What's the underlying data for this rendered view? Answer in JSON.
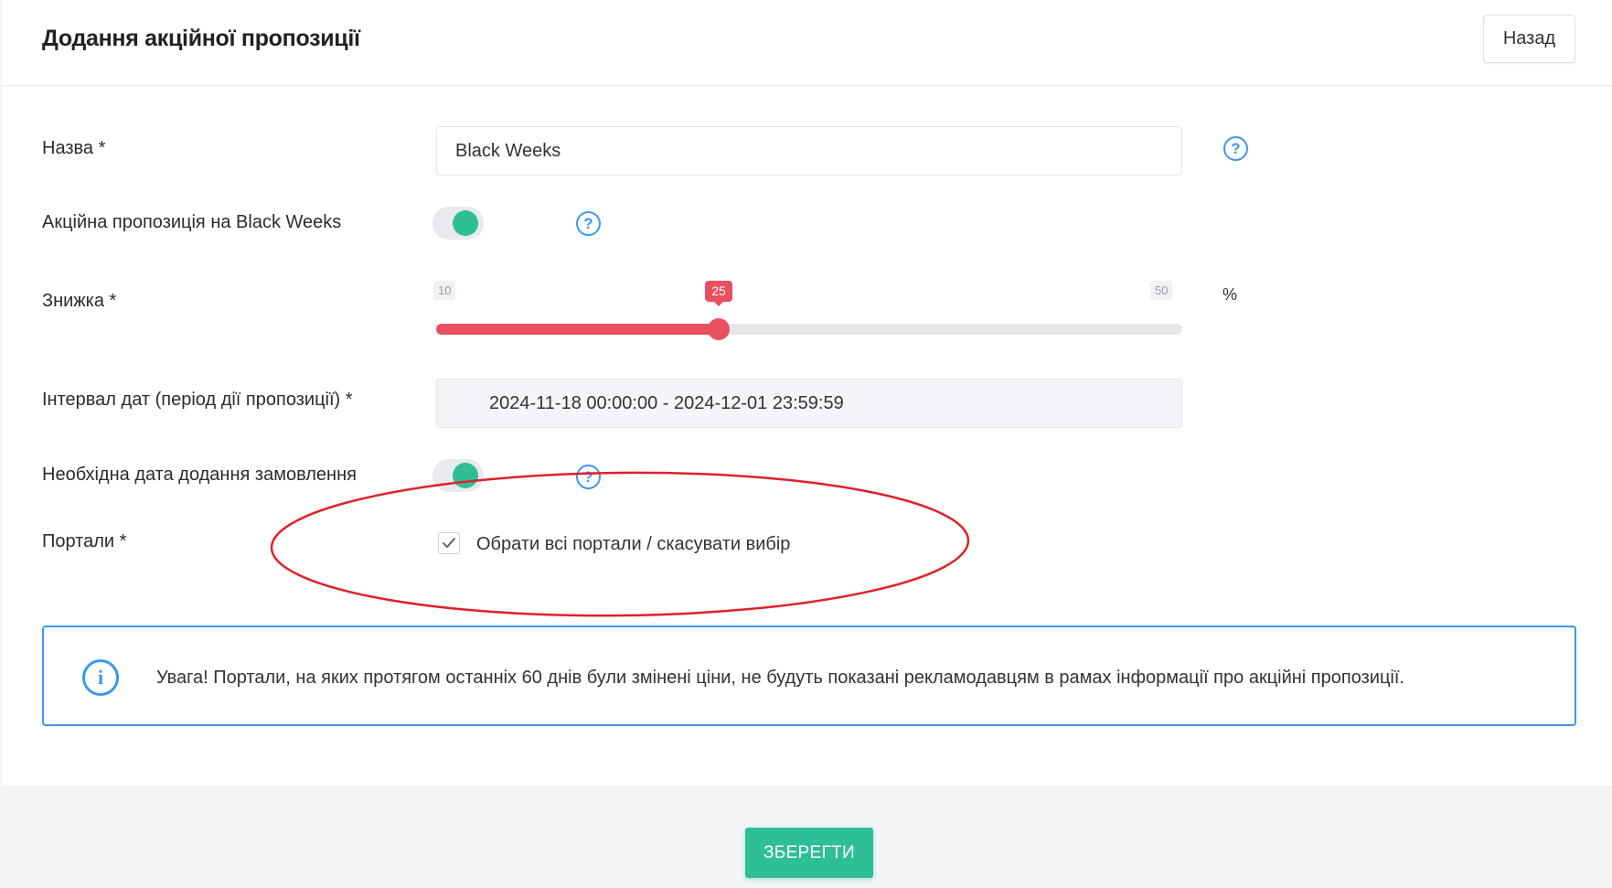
{
  "header": {
    "title": "Додання акційної пропозиції",
    "back_label": "Назад"
  },
  "form": {
    "name": {
      "label": "Назва *",
      "value": "Black Weeks"
    },
    "black_weeks": {
      "label": "Акційна пропозиція на Black Weeks",
      "enabled": true
    },
    "discount": {
      "label": "Знижка *",
      "min": 10,
      "max": 50,
      "value": 25,
      "unit": "%"
    },
    "date_interval": {
      "label": "Інтервал дат (період дії пропозиції) *",
      "value": "2024-11-18 00:00:00 - 2024-12-01 23:59:59"
    },
    "order_date_required": {
      "label": "Необхідна дата додання замовлення",
      "enabled": true
    },
    "portals": {
      "label": "Портали *",
      "select_all_label": "Обрати всі портали / скасувати вибір",
      "checked": true
    }
  },
  "alert": {
    "icon": "info-icon",
    "text": "Увага! Портали, на яких протягом останніх 60 днів були змінені ціни, не будуть показані рекламодавцям в рамах інформації про акційні пропозиції."
  },
  "footer": {
    "save_label": "ЗБЕРЕГТИ"
  },
  "colors": {
    "accent": "#2fbf97",
    "slider": "#e9505f",
    "info": "#3a98f0",
    "annotation": "#e0202a"
  }
}
